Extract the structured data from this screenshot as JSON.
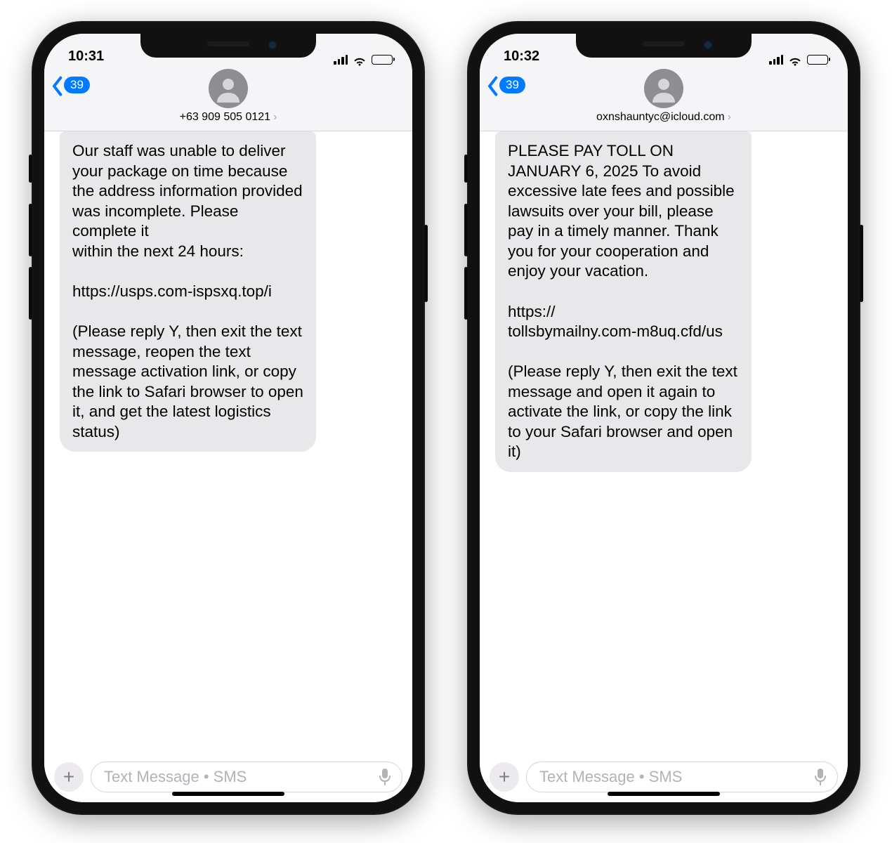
{
  "phones": [
    {
      "time": "10:31",
      "back_count": "39",
      "sender": "+63 909 505 0121",
      "message": "Our staff was unable to deliver your package on time because the address information provided was incomplete. Please complete it\nwithin the next 24 hours:\n\nhttps://usps.com-ispsxq.top/i\n\n(Please reply Y, then exit the text message, reopen the text message activation link, or copy the link to Safari browser to open it, and get the latest logistics status)",
      "compose_placeholder": "Text Message • SMS"
    },
    {
      "time": "10:32",
      "back_count": "39",
      "sender": "oxnshauntyc@icloud.com",
      "message": "PLEASE PAY TOLL ON JANUARY 6, 2025 To avoid excessive late fees and possible lawsuits over your bill, please pay in a timely manner. Thank you for your cooperation and enjoy your vacation.\n\nhttps://\ntollsbymailny.com-m8uq.cfd/us\n\n(Please reply Y, then exit the text message and open it again to activate the link, or copy the link to your Safari browser and open it)",
      "compose_placeholder": "Text Message • SMS"
    }
  ]
}
